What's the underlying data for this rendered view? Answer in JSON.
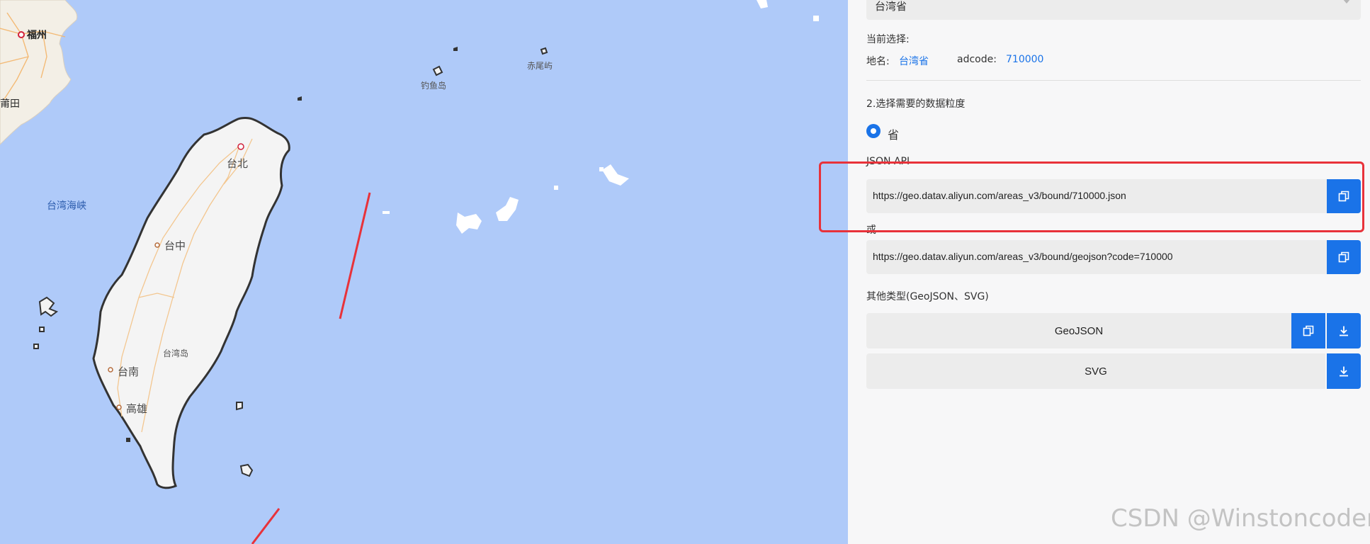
{
  "map": {
    "labels": {
      "fuzhou": "福州",
      "putian": "莆田",
      "strait": "台湾海峡",
      "taipei": "台北",
      "taichung": "台中",
      "tainan": "台南",
      "kaohsiung": "高雄",
      "taiwan_island": "台湾岛",
      "diaoyu": "钓鱼岛",
      "chiwei": "赤尾屿"
    }
  },
  "panel": {
    "region_select_value": "台湾省",
    "current_selection_label": "当前选择:",
    "place_name_label": "地名:",
    "place_name_value": "台湾省",
    "adcode_label": "adcode:",
    "adcode_value": "710000",
    "step2_title": "2.选择需要的数据粒度",
    "granularity_option": "省",
    "json_api_label": "JSON API",
    "api_url_1": "https://geo.datav.aliyun.com/areas_v3/bound/710000.json",
    "or_label": "或",
    "api_url_2": "https://geo.datav.aliyun.com/areas_v3/bound/geojson?code=710000",
    "other_types_label": "其他类型(GeoJSON、SVG)",
    "geojson_label": "GeoJSON",
    "svg_label": "SVG"
  },
  "watermark": "CSDN @Winstoncoder",
  "colors": {
    "accent": "#1a73e8",
    "highlight": "#e8323a",
    "sea": "#afcaf9",
    "land": "#f4f4f4"
  },
  "icons": {
    "copy": "copy-icon",
    "download": "download-icon",
    "caret": "chevron-down-icon"
  }
}
